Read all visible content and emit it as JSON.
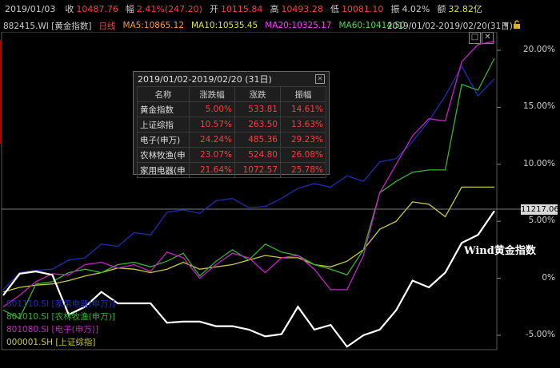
{
  "topbar": {
    "date": "2019/01/03",
    "close_label": "收",
    "close_value": "10487.76",
    "change_label": "幅",
    "change_value": "2.41%(247.20)",
    "open_label": "开",
    "open_value": "10115.84",
    "high_label": "高",
    "high_value": "10493.28",
    "low_label": "低",
    "low_value": "10081.10",
    "amp_label": "振",
    "amp_value": "4.02%",
    "amount_label": "额",
    "amount_value": "32.82亿"
  },
  "maline": {
    "code": "882415.WI [黄金指数]",
    "daily": "日线",
    "ma5": "MA5:10865.12",
    "ma10": "MA10:10535.45",
    "ma20": "MA20:10325.17",
    "ma60": "MA60:10414.50",
    "range": "2019/01/02-2019/02/20(31日)"
  },
  "colors": {
    "gold_index": "#ffffff",
    "electronics": "#c81fc8",
    "agriculture": "#2fb52f",
    "shanghai": "#c8c83a",
    "appliances": "#1a2fb0",
    "red": "#ff3b3b",
    "ma5": "#ff9a2e",
    "ma10": "#e0e040",
    "ma20": "#ff38ff",
    "ma60": "#4fd84f"
  },
  "icons": [
    "maximize-icon",
    "close-icon",
    "dropdown-triangle-icon",
    "lock-icon"
  ],
  "price_tag": "11217.06",
  "wind_label": "Wind黄金指数",
  "panel": {
    "title": "2019/01/02-2019/02/20 (31日)",
    "headers": [
      "名称",
      "涨跌幅",
      "涨跌",
      "振幅"
    ],
    "rows": [
      {
        "name": "黄金指数",
        "pct": "5.00%",
        "chg": "533.81",
        "amp": "14.61%"
      },
      {
        "name": "上证综指",
        "pct": "10.57%",
        "chg": "263.50",
        "amp": "13.63%"
      },
      {
        "name": "电子(申万)",
        "pct": "24.24%",
        "chg": "485.36",
        "amp": "29.23%"
      },
      {
        "name": "农林牧渔(申",
        "pct": "23.07%",
        "chg": "524.80",
        "amp": "26.08%"
      },
      {
        "name": "家用电器(申",
        "pct": "21.64%",
        "chg": "1072.57",
        "amp": "25.78%"
      }
    ]
  },
  "legend": [
    {
      "text": "801110.SI [家用电器(申万)]",
      "color": "#1a2fb0"
    },
    {
      "text": "801010.SI [农林牧渔(申万)]",
      "color": "#2fb52f"
    },
    {
      "text": "801080.SI [电子(申万)]",
      "color": "#c81fc8"
    },
    {
      "text": "000001.SH [上证综指]",
      "color": "#c8c83a"
    }
  ],
  "chart_data": {
    "type": "line",
    "ylim": [
      -5.0,
      21.0
    ],
    "yticks": [
      "20.00%",
      "15.00%",
      "10.00%",
      "5.00%",
      "0%",
      "-5.00%"
    ],
    "ytick_values": [
      20,
      15,
      10,
      5,
      0,
      -5
    ],
    "x": [
      1,
      2,
      3,
      4,
      5,
      6,
      7,
      8,
      9,
      10,
      11,
      12,
      13,
      14,
      15,
      16,
      17,
      18,
      19,
      20,
      21,
      22,
      23,
      24,
      25,
      26,
      27,
      28,
      29,
      30,
      31
    ],
    "series": [
      {
        "name": "Wind黄金指数",
        "color": "#ffffff",
        "values": [
          -1.5,
          0.4,
          0.6,
          0.3,
          -3.2,
          -2.5,
          -1.2,
          -2.2,
          -2.2,
          -2.2,
          -3.9,
          -3.8,
          -3.8,
          -4.2,
          -4.2,
          -4.5,
          -5.1,
          -4.9,
          -2.5,
          -4.5,
          -4.1,
          -6.0,
          -5.0,
          -4.5,
          -2.8,
          -0.2,
          -0.8,
          0.5,
          3.1,
          3.8,
          5.9
        ]
      },
      {
        "name": "801080.SI [电子(申万)]",
        "color": "#c81fc8",
        "values": [
          -2.5,
          -1.5,
          -0.3,
          0.4,
          0.3,
          1.2,
          1.4,
          0.9,
          1.2,
          0.6,
          2.3,
          1.8,
          0.0,
          1.2,
          2.2,
          1.8,
          0.5,
          1.8,
          2.0,
          0.8,
          -1.0,
          -1.0,
          2.0,
          7.5,
          10.0,
          12.5,
          14.0,
          13.8,
          19.0,
          20.5,
          20.8
        ]
      },
      {
        "name": "801010.SI [农林牧渔(申万)]",
        "color": "#2fb52f",
        "values": [
          -2.8,
          -3.5,
          -0.5,
          -0.3,
          0.5,
          0.8,
          0.5,
          1.2,
          1.4,
          1.0,
          1.5,
          2.2,
          0.2,
          1.5,
          2.5,
          1.6,
          3.0,
          2.3,
          2.0,
          1.2,
          0.8,
          0.3,
          2.5,
          7.5,
          8.5,
          9.3,
          9.5,
          9.5,
          17.0,
          16.5,
          19.3
        ]
      },
      {
        "name": "000001.SH [上证综指]",
        "color": "#c8c83a",
        "values": [
          -1.2,
          -0.8,
          -0.6,
          -0.5,
          -0.2,
          0.2,
          0.5,
          0.9,
          0.8,
          0.5,
          0.8,
          1.4,
          0.8,
          1.0,
          1.2,
          1.6,
          2.0,
          1.8,
          1.8,
          1.2,
          1.0,
          1.5,
          2.5,
          4.3,
          5.0,
          6.7,
          6.5,
          5.4,
          8.0,
          8.0,
          8.0
        ]
      },
      {
        "name": "801110.SI [家用电器(申万)]",
        "color": "#1a2fb0",
        "values": [
          -1.0,
          0.5,
          0.7,
          0.8,
          1.6,
          1.8,
          3.0,
          2.8,
          4.0,
          3.8,
          5.8,
          6.0,
          5.7,
          6.8,
          7.0,
          6.2,
          6.3,
          7.0,
          7.9,
          8.3,
          8.0,
          9.0,
          8.5,
          10.2,
          10.5,
          12.0,
          13.8,
          16.0,
          18.6,
          16.0,
          17.5
        ]
      }
    ]
  }
}
